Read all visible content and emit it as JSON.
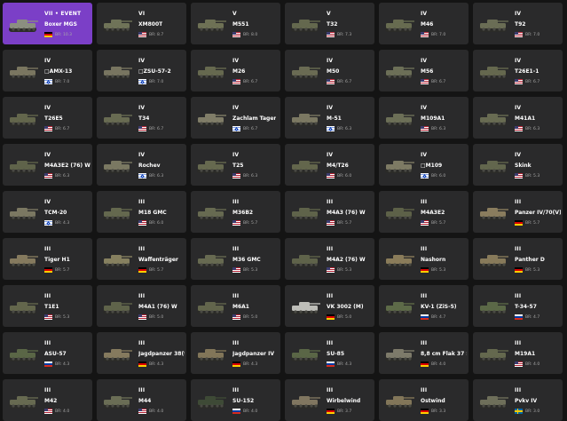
{
  "vehicles": [
    {
      "rank": "VII • EVENT",
      "name": "Boxer MGS",
      "br": "BR: 10.3",
      "flag": "germany",
      "event": true,
      "tank": "#8b8f80"
    },
    {
      "rank": "VI",
      "name": "XM800T",
      "br": "BR: 8.7",
      "flag": "usa",
      "tank": "#6f7358"
    },
    {
      "rank": "V",
      "name": "M551",
      "br": "BR: 8.0",
      "flag": "usa",
      "tank": "#6e7155"
    },
    {
      "rank": "V",
      "name": "T32",
      "br": "BR: 7.3",
      "flag": "usa",
      "tank": "#64684e"
    },
    {
      "rank": "IV",
      "name": "M46",
      "br": "BR: 7.0",
      "flag": "usa",
      "tank": "#676b50"
    },
    {
      "rank": "IV",
      "name": "T92",
      "br": "BR: 7.0",
      "flag": "usa",
      "tank": "#6a6d55"
    },
    {
      "rank": "IV",
      "name": "□AMX-13",
      "br": "BR: 7.0",
      "flag": "israel",
      "tank": "#7a7660"
    },
    {
      "rank": "IV",
      "name": "□ZSU-57-2",
      "br": "BR: 7.0",
      "flag": "israel",
      "tank": "#787560"
    },
    {
      "rank": "IV",
      "name": "M26",
      "br": "BR: 6.7",
      "flag": "usa",
      "tank": "#66694f"
    },
    {
      "rank": "IV",
      "name": "M50",
      "br": "BR: 6.7",
      "flag": "usa",
      "tank": "#6a6b53"
    },
    {
      "rank": "IV",
      "name": "M56",
      "br": "BR: 6.7",
      "flag": "usa",
      "tank": "#6c6f57"
    },
    {
      "rank": "IV",
      "name": "T26E1-1",
      "br": "BR: 6.7",
      "flag": "usa",
      "tank": "#65684e"
    },
    {
      "rank": "IV",
      "name": "T26E5",
      "br": "BR: 6.7",
      "flag": "usa",
      "tank": "#63664c"
    },
    {
      "rank": "IV",
      "name": "T34",
      "br": "BR: 6.7",
      "flag": "usa",
      "tank": "#686b52"
    },
    {
      "rank": "IV",
      "name": "Zachlam Tager",
      "br": "BR: 6.7",
      "flag": "israel",
      "tank": "#807d68"
    },
    {
      "rank": "IV",
      "name": "M-51",
      "br": "BR: 6.3",
      "flag": "israel",
      "tank": "#7b7862"
    },
    {
      "rank": "IV",
      "name": "M109A1",
      "br": "BR: 6.3",
      "flag": "usa",
      "tank": "#6c6f57"
    },
    {
      "rank": "IV",
      "name": "M41A1",
      "br": "BR: 6.3",
      "flag": "usa",
      "tank": "#686b52"
    },
    {
      "rank": "IV",
      "name": "M4A3E2 (76) W",
      "br": "BR: 6.3",
      "flag": "usa",
      "tank": "#5f634a"
    },
    {
      "rank": "IV",
      "name": "Rochev",
      "br": "BR: 6.3",
      "flag": "israel",
      "tank": "#7a7862"
    },
    {
      "rank": "IV",
      "name": "T25",
      "br": "BR: 6.3",
      "flag": "usa",
      "tank": "#66694f"
    },
    {
      "rank": "IV",
      "name": "M4/T26",
      "br": "BR: 6.0",
      "flag": "usa",
      "tank": "#63664c"
    },
    {
      "rank": "IV",
      "name": "□M109",
      "br": "BR: 6.0",
      "flag": "israel",
      "tank": "#7d7a64"
    },
    {
      "rank": "IV",
      "name": "Skink",
      "br": "BR: 5.3",
      "flag": "usa",
      "tank": "#62664d"
    },
    {
      "rank": "IV",
      "name": "TCM-20",
      "br": "BR: 4.3",
      "flag": "israel",
      "tank": "#7b7862"
    },
    {
      "rank": "III",
      "name": "M18 GMC",
      "br": "BR: 6.0",
      "flag": "usa",
      "tank": "#64684e"
    },
    {
      "rank": "III",
      "name": "M36B2",
      "br": "BR: 5.7",
      "flag": "usa",
      "tank": "#676a51"
    },
    {
      "rank": "III",
      "name": "M4A3 (76) W",
      "br": "BR: 5.7",
      "flag": "usa",
      "tank": "#5f634a"
    },
    {
      "rank": "III",
      "name": "M4A3E2",
      "br": "BR: 5.7",
      "flag": "usa",
      "tank": "#5d6148"
    },
    {
      "rank": "III",
      "name": "Panzer IV/70(V)",
      "br": "BR: 5.7",
      "flag": "germany",
      "tank": "#8a7d5e"
    },
    {
      "rank": "III",
      "name": "Tiger H1",
      "br": "BR: 5.7",
      "flag": "germany",
      "tank": "#857a5e"
    },
    {
      "rank": "III",
      "name": "Waffenträger",
      "br": "BR: 5.7",
      "flag": "germany",
      "tank": "#86805f"
    },
    {
      "rank": "III",
      "name": "M36 GMC",
      "br": "BR: 5.3",
      "flag": "usa",
      "tank": "#676a51"
    },
    {
      "rank": "III",
      "name": "M4A2 (76) W",
      "br": "BR: 5.3",
      "flag": "usa",
      "tank": "#5f634a"
    },
    {
      "rank": "III",
      "name": "Nashorn",
      "br": "BR: 5.3",
      "flag": "germany",
      "tank": "#8a7c5a"
    },
    {
      "rank": "III",
      "name": "Panther D",
      "br": "BR: 5.3",
      "flag": "germany",
      "tank": "#877a5a"
    },
    {
      "rank": "III",
      "name": "T1E1",
      "br": "BR: 5.3",
      "flag": "usa",
      "tank": "#63664c"
    },
    {
      "rank": "III",
      "name": "M4A1 (76) W",
      "br": "BR: 5.0",
      "flag": "usa",
      "tank": "#5f634a"
    },
    {
      "rank": "III",
      "name": "M6A1",
      "br": "BR: 5.0",
      "flag": "usa",
      "tank": "#62654c"
    },
    {
      "rank": "III",
      "name": "VK 3002 (M)",
      "br": "BR: 5.0",
      "flag": "germany",
      "tank": "#bdbdb8"
    },
    {
      "rank": "III",
      "name": "KV-1 (ZiS-5)",
      "br": "BR: 4.7",
      "flag": "russia",
      "tank": "#5d6a48"
    },
    {
      "rank": "III",
      "name": "T-34-57",
      "br": "BR: 4.7",
      "flag": "russia",
      "tank": "#5b6847"
    },
    {
      "rank": "III",
      "name": "ASU-57",
      "br": "BR: 4.3",
      "flag": "russia",
      "tank": "#5a6646"
    },
    {
      "rank": "III",
      "name": "Jagdpanzer 38(t)",
      "br": "BR: 4.3",
      "flag": "germany",
      "tank": "#857a5e"
    },
    {
      "rank": "III",
      "name": "Jagdpanzer IV",
      "br": "BR: 4.3",
      "flag": "germany",
      "tank": "#827659"
    },
    {
      "rank": "III",
      "name": "SU-85",
      "br": "BR: 4.3",
      "flag": "russia",
      "tank": "#5a6646"
    },
    {
      "rank": "III",
      "name": "8,8 cm Flak 37 Sfl.",
      "br": "BR: 4.0",
      "flag": "germany",
      "tank": "#7d7a6a"
    },
    {
      "rank": "III",
      "name": "M19A1",
      "br": "BR: 4.0",
      "flag": "usa",
      "tank": "#64684e"
    },
    {
      "rank": "III",
      "name": "M42",
      "br": "BR: 4.0",
      "flag": "usa",
      "tank": "#676a51"
    },
    {
      "rank": "III",
      "name": "M44",
      "br": "BR: 4.0",
      "flag": "usa",
      "tank": "#6a6d55"
    },
    {
      "rank": "III",
      "name": "SU-152",
      "br": "BR: 4.0",
      "flag": "russia",
      "tank": "#3e4a36"
    },
    {
      "rank": "III",
      "name": "Wirbelwind",
      "br": "BR: 3.7",
      "flag": "germany",
      "tank": "#807660"
    },
    {
      "rank": "III",
      "name": "Ostwind",
      "br": "BR: 3.3",
      "flag": "germany",
      "tank": "#827659"
    },
    {
      "rank": "III",
      "name": "Pvkv IV",
      "br": "BR: 3.0",
      "flag": "sweden",
      "tank": "#6e6f5a"
    }
  ]
}
